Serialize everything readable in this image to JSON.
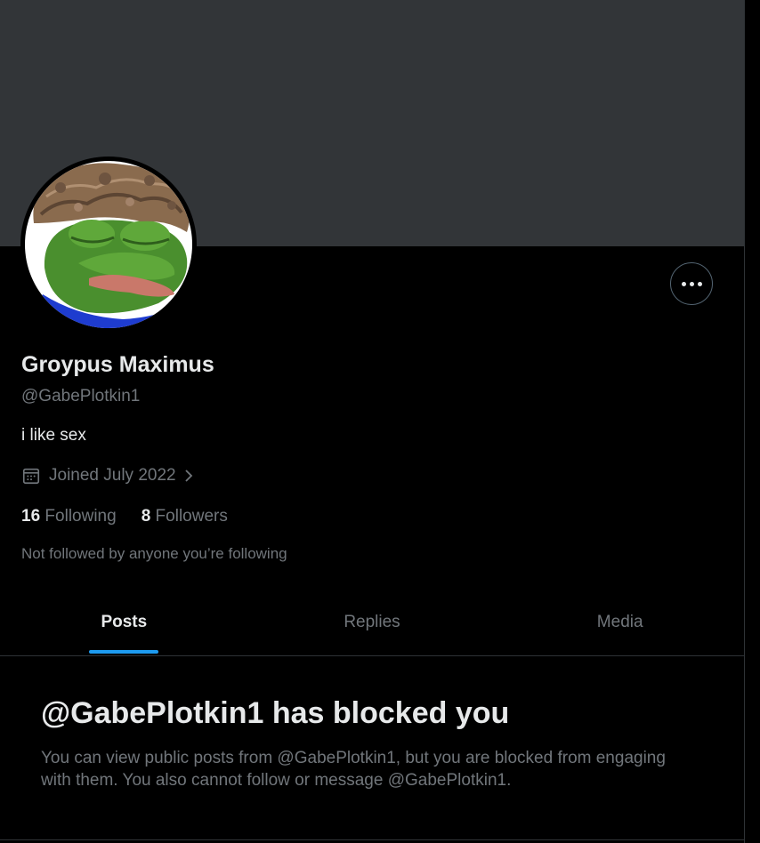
{
  "profile": {
    "display_name": "Groypus Maximus",
    "handle": "@GabePlotkin1",
    "bio": "i like sex",
    "joined": "Joined July 2022",
    "following_count": "16",
    "following_label": "Following",
    "followers_count": "8",
    "followers_label": "Followers",
    "not_followed_text": "Not followed by anyone you’re following"
  },
  "icons": {
    "more": "more-horizontal-icon",
    "calendar": "calendar-icon",
    "chevron": "chevron-right-icon"
  },
  "tabs": [
    {
      "label": "Posts",
      "active": true
    },
    {
      "label": "Replies",
      "active": false
    },
    {
      "label": "Media",
      "active": false
    }
  ],
  "blocked": {
    "title": "@GabePlotkin1 has blocked you",
    "description": "You can view public posts from @GabePlotkin1, but you are blocked from engaging with them. You also cannot follow or message @GabePlotkin1."
  },
  "colors": {
    "background": "#000000",
    "banner": "#323538",
    "text_primary": "#e7e9ea",
    "text_secondary": "#71767b",
    "accent": "#1d9bf0",
    "border": "#2f3336"
  }
}
